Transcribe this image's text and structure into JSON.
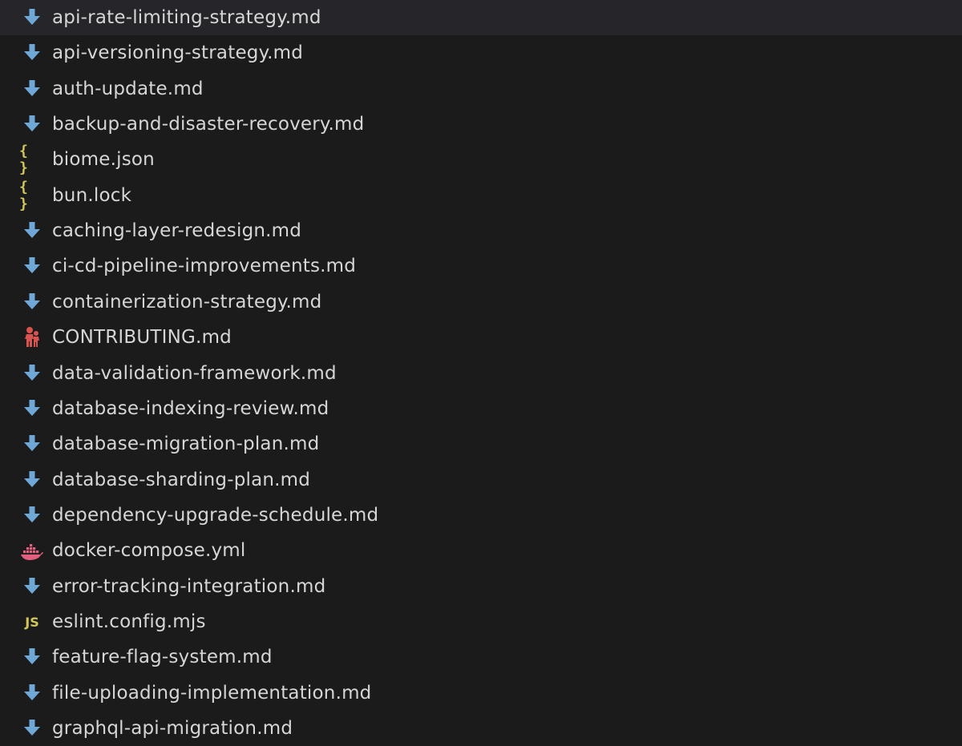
{
  "explorer": {
    "files": [
      {
        "name": "api-rate-limiting-strategy.md",
        "icon": "markdown-arrow-icon"
      },
      {
        "name": "api-versioning-strategy.md",
        "icon": "markdown-arrow-icon"
      },
      {
        "name": "auth-update.md",
        "icon": "markdown-arrow-icon"
      },
      {
        "name": "backup-and-disaster-recovery.md",
        "icon": "markdown-arrow-icon"
      },
      {
        "name": "biome.json",
        "icon": "json-braces-icon"
      },
      {
        "name": "bun.lock",
        "icon": "json-braces-icon"
      },
      {
        "name": "caching-layer-redesign.md",
        "icon": "markdown-arrow-icon"
      },
      {
        "name": "ci-cd-pipeline-improvements.md",
        "icon": "markdown-arrow-icon"
      },
      {
        "name": "containerization-strategy.md",
        "icon": "markdown-arrow-icon"
      },
      {
        "name": "CONTRIBUTING.md",
        "icon": "contributing-people-icon"
      },
      {
        "name": "data-validation-framework.md",
        "icon": "markdown-arrow-icon"
      },
      {
        "name": "database-indexing-review.md",
        "icon": "markdown-arrow-icon"
      },
      {
        "name": "database-migration-plan.md",
        "icon": "markdown-arrow-icon"
      },
      {
        "name": "database-sharding-plan.md",
        "icon": "markdown-arrow-icon"
      },
      {
        "name": "dependency-upgrade-schedule.md",
        "icon": "markdown-arrow-icon"
      },
      {
        "name": "docker-compose.yml",
        "icon": "docker-whale-icon"
      },
      {
        "name": "error-tracking-integration.md",
        "icon": "markdown-arrow-icon"
      },
      {
        "name": "eslint.config.mjs",
        "icon": "javascript-icon"
      },
      {
        "name": "feature-flag-system.md",
        "icon": "markdown-arrow-icon"
      },
      {
        "name": "file-uploading-implementation.md",
        "icon": "markdown-arrow-icon"
      },
      {
        "name": "graphql-api-migration.md",
        "icon": "markdown-arrow-icon"
      }
    ],
    "icons": {
      "json_glyph": "{}",
      "js_glyph": "JS"
    }
  },
  "colors": {
    "background": "#1b1b1c",
    "text": "#d6d6d6",
    "markdown_icon": "#6fa8d6",
    "json_icon": "#d4c75a",
    "contributing_icon": "#d9534f",
    "docker_icon": "#e0607e"
  }
}
